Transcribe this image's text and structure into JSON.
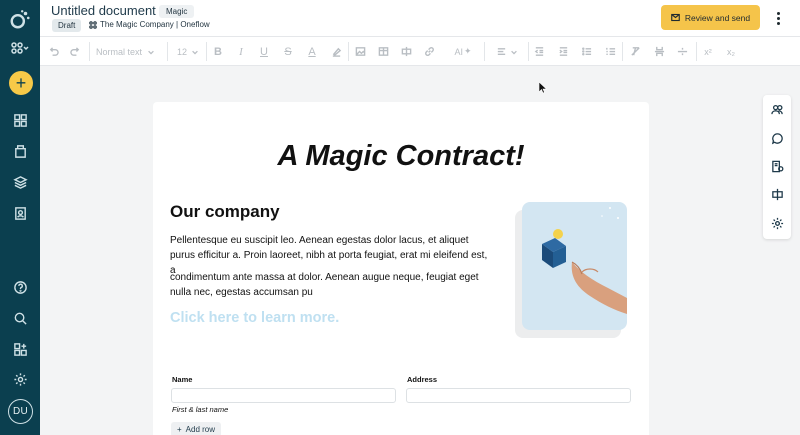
{
  "header": {
    "doc_title": "Untitled document",
    "magic_tag": "Magic",
    "status_badge": "Draft",
    "company": "The Magic Company | Oneflow",
    "review_button": "Review and send"
  },
  "toolbar": {
    "text_style": "Normal text",
    "font_size": "12",
    "ai_label": "AI",
    "superscript": "x²",
    "subscript": "x₂"
  },
  "sidebar": {
    "add_label": "+",
    "avatar_initials": "DU"
  },
  "document": {
    "heading": "A Magic Contract!",
    "section_title": "Our company",
    "paragraph_1": "Pellentesque eu suscipit leo. Aenean egestas dolor lacus, et aliquet purus efficitur a. Proin laoreet, nibh at porta feugiat, erat mi eleifend est, a",
    "paragraph_2": "condimentum ante massa at dolor. Aenean augue neque, feugiat eget nulla nec, egestas accumsan pu",
    "link_text": "Click here to learn more.",
    "fields": {
      "name_label": "Name",
      "address_label": "Address",
      "name_help": "First & last name",
      "add_row": "Add row"
    }
  },
  "colors": {
    "sidebar": "#0b3f4f",
    "accent": "#f5c44a",
    "link": "#bfe0f1"
  }
}
